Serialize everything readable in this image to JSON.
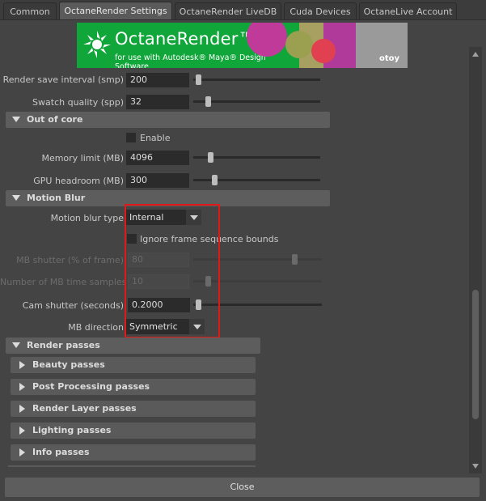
{
  "tabs": [
    {
      "label": "Common"
    },
    {
      "label": "OctaneRender Settings"
    },
    {
      "label": "OctaneRender LiveDB"
    },
    {
      "label": "Cuda Devices"
    },
    {
      "label": "OctaneLive Account"
    }
  ],
  "banner": {
    "title": "OctaneRender™",
    "subtitle": "for use with Autodesk® Maya® Design Software",
    "brand": "otoy"
  },
  "render_settings": {
    "save_interval_label": "Render save interval (smp)",
    "save_interval_value": "200",
    "save_interval_level": 0.02,
    "swatch_quality_label": "Swatch quality (spp)",
    "swatch_quality_value": "32",
    "swatch_quality_level": 0.1
  },
  "out_of_core": {
    "title": "Out of core",
    "enable_label": "Enable",
    "enable_checked": false,
    "memory_limit_label": "Memory limit (MB)",
    "memory_limit_value": "4096",
    "memory_limit_level": 0.12,
    "gpu_headroom_label": "GPU headroom (MB)",
    "gpu_headroom_value": "300",
    "gpu_headroom_level": 0.15
  },
  "motion_blur": {
    "title": "Motion Blur",
    "type_label": "Motion blur type",
    "type_value": "Internal",
    "ignore_bounds_label": "Ignore frame sequence bounds",
    "ignore_bounds_checked": false,
    "shutter_label": "MB shutter (% of frame)",
    "shutter_value": "80",
    "shutter_level": 0.8,
    "time_samples_label": "Number of MB time samples",
    "time_samples_value": "10",
    "time_samples_level": 0.1,
    "cam_shutter_label": "Cam shutter (seconds)",
    "cam_shutter_value": "0.2000",
    "cam_shutter_level": 0.02,
    "direction_label": "MB direction",
    "direction_value": "Symmetric"
  },
  "render_passes": {
    "title": "Render passes",
    "groups": [
      {
        "label": "Beauty passes"
      },
      {
        "label": "Post Processing passes"
      },
      {
        "label": "Render Layer passes"
      },
      {
        "label": "Lighting passes"
      },
      {
        "label": "Info passes"
      }
    ]
  },
  "footer": {
    "close_label": "Close"
  },
  "colors": {
    "accent_highlight": "#e01818",
    "banner_green": "#10a63a",
    "panel_bg": "#444444"
  }
}
